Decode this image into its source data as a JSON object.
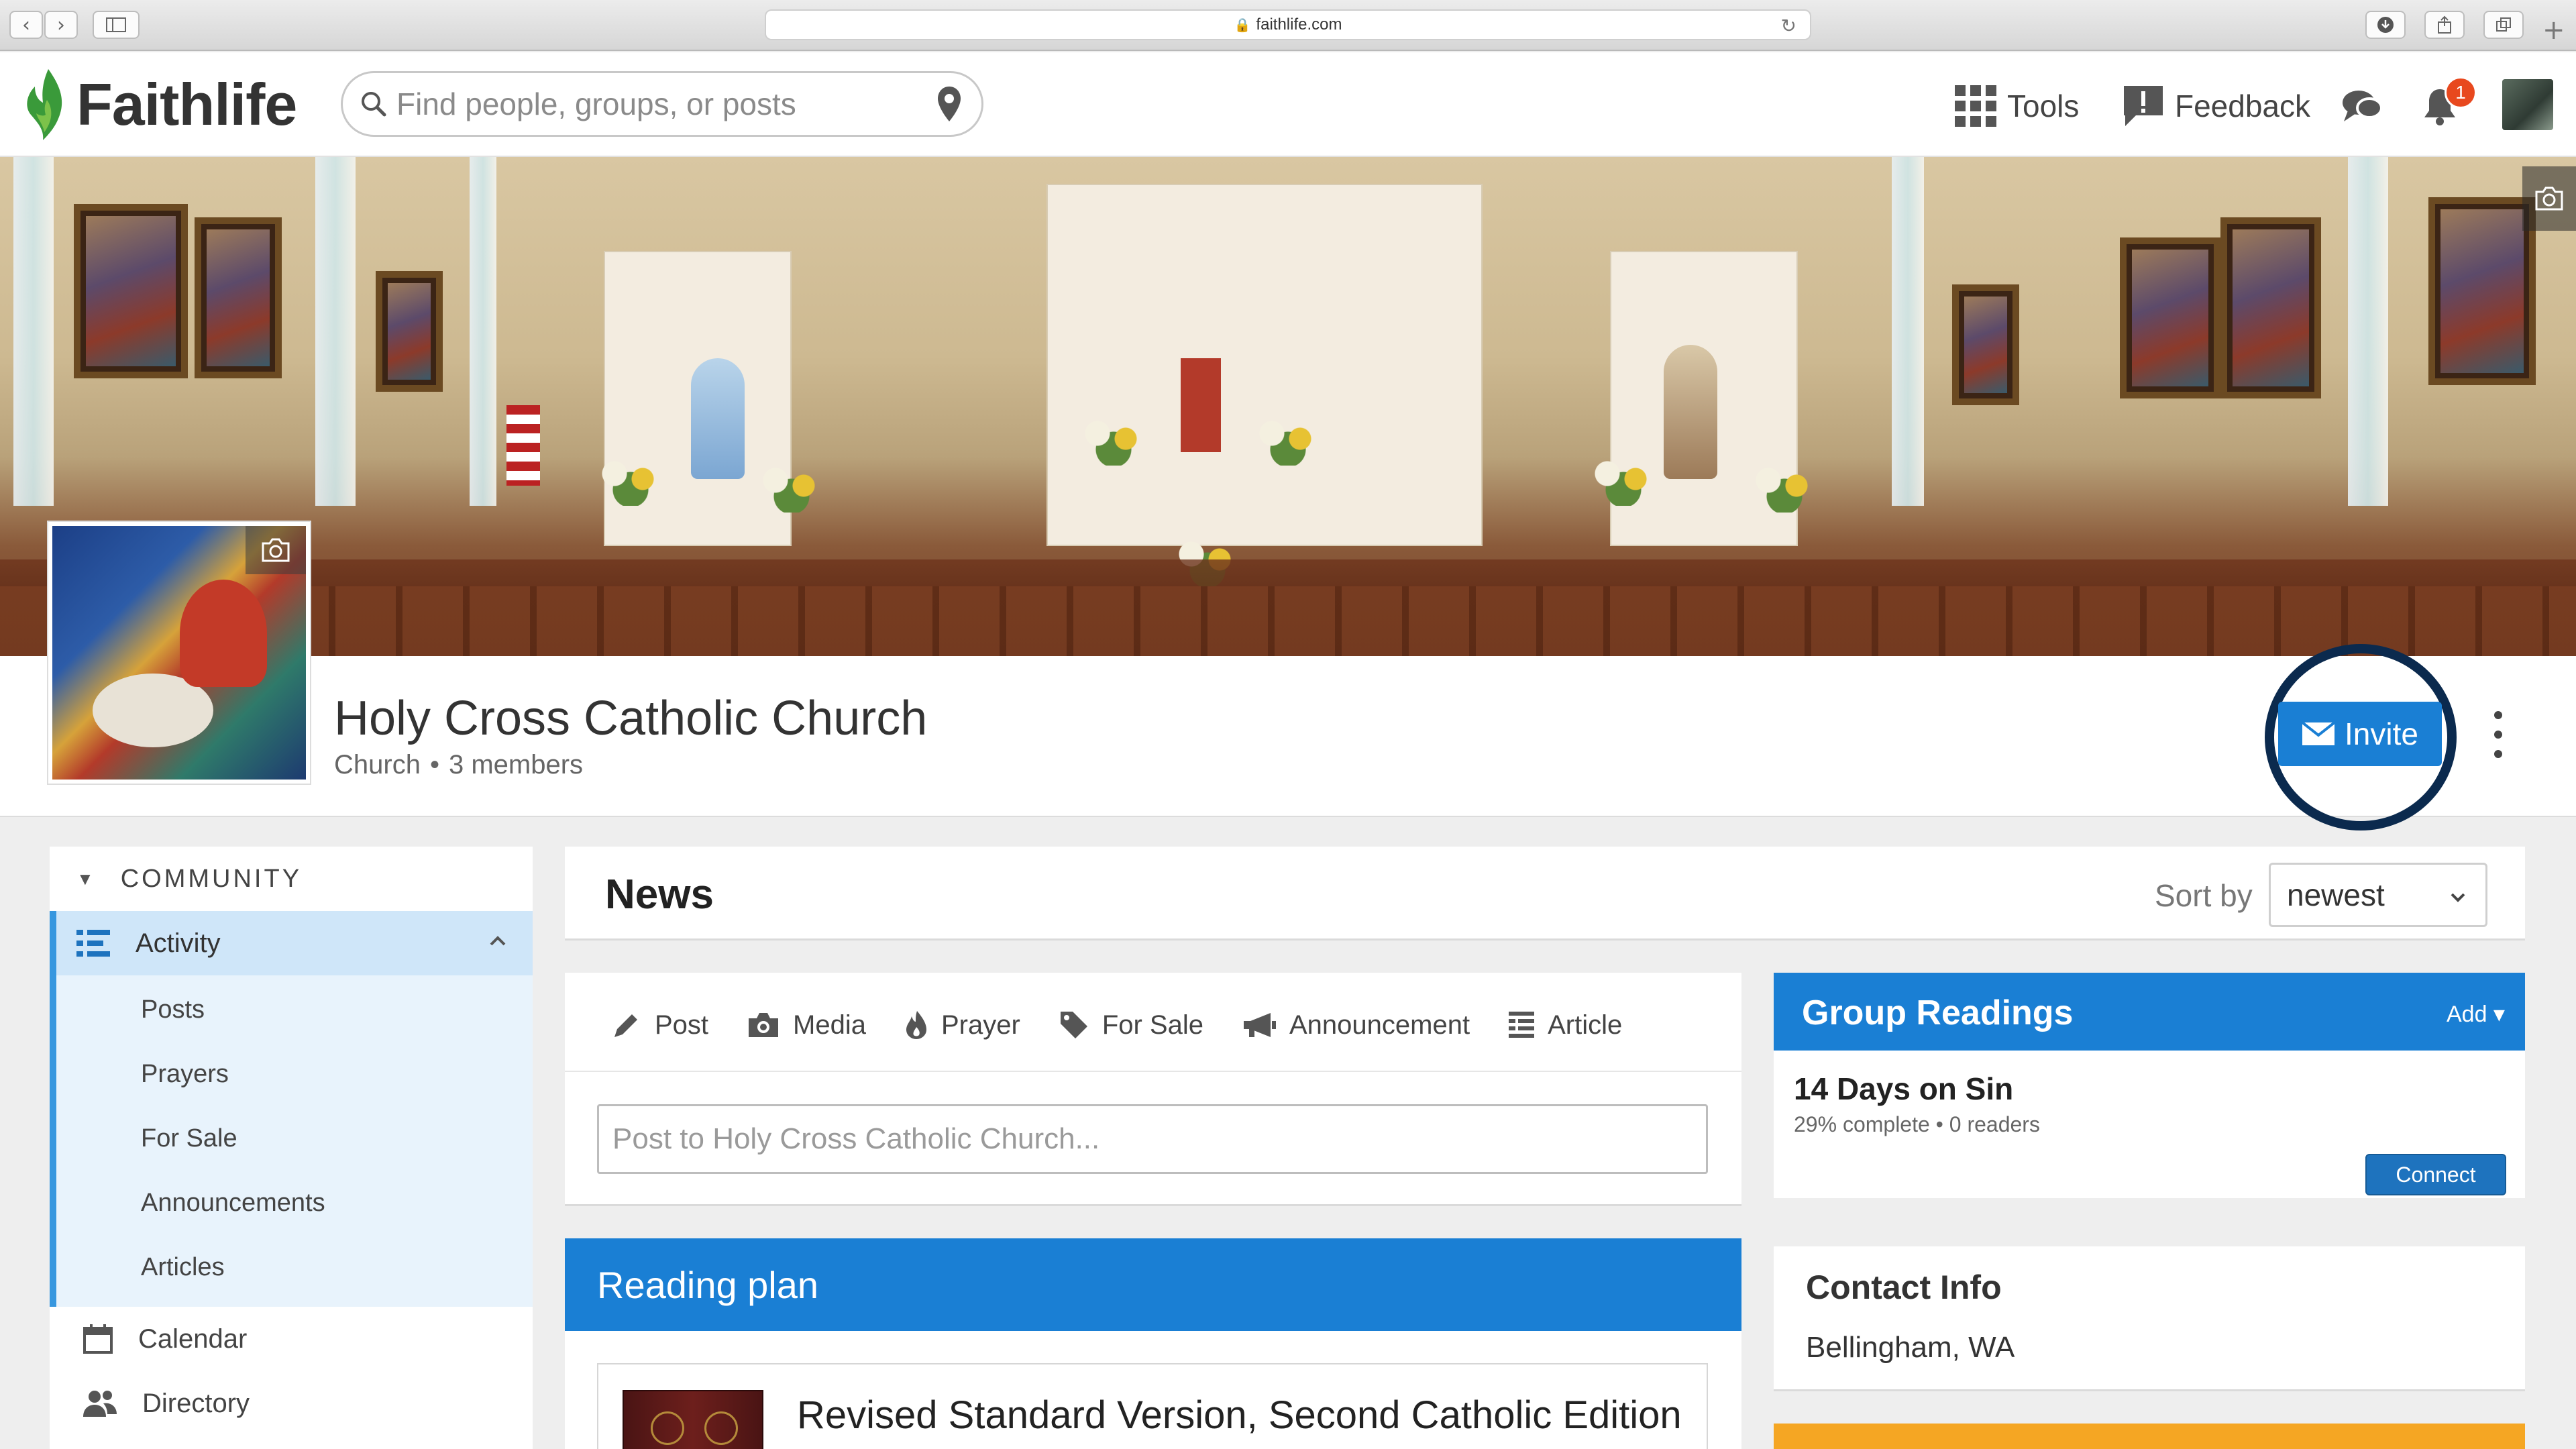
{
  "browser": {
    "url": "faithlife.com"
  },
  "header": {
    "logo_text": "Faithlife",
    "search_placeholder": "Find people, groups, or posts",
    "tools_label": "Tools",
    "feedback_label": "Feedback",
    "notification_count": "1"
  },
  "profile": {
    "name": "Holy Cross Catholic Church",
    "type": "Church",
    "members": "3 members",
    "invite_label": "Invite"
  },
  "sidebar": {
    "section": "COMMUNITY",
    "active": "Activity",
    "sub_items": [
      "Posts",
      "Prayers",
      "For Sale",
      "Announcements",
      "Articles"
    ],
    "items": [
      "Calendar",
      "Directory"
    ]
  },
  "news": {
    "title": "News",
    "sort_label": "Sort by",
    "sort_value": "newest"
  },
  "composer": {
    "post_types": [
      "Post",
      "Media",
      "Prayer",
      "For Sale",
      "Announcement",
      "Article"
    ],
    "placeholder": "Post to Holy Cross Catholic Church..."
  },
  "reading_plan": {
    "title": "Reading plan",
    "book_title": "Revised Standard Version, Second Catholic Edition"
  },
  "group_readings": {
    "title": "Group Readings",
    "add_label": "Add ▾",
    "plan_name": "14 Days on Sin",
    "progress": "29% complete • 0 readers",
    "connect_label": "Connect"
  },
  "contact": {
    "title": "Contact Info",
    "location": "Bellingham, WA"
  },
  "colors": {
    "primary_blue": "#1a7fd4",
    "accent_green": "#3a9a3a",
    "highlight_ring": "#0b2a4e",
    "badge_red": "#e8481e"
  }
}
